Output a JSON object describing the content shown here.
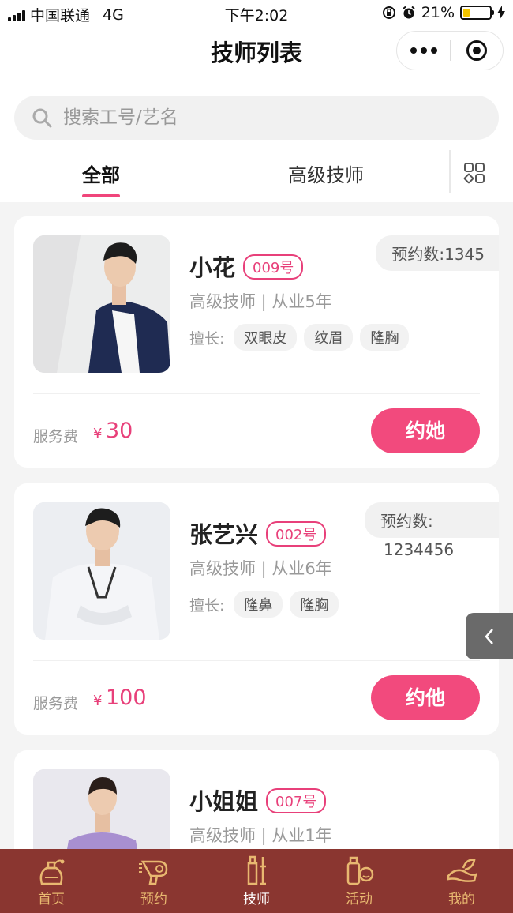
{
  "status_bar": {
    "carrier": "中国联通",
    "network": "4G",
    "time": "下午2:02",
    "battery": "21%"
  },
  "nav": {
    "title": "技师列表"
  },
  "search": {
    "placeholder": "搜索工号/艺名"
  },
  "tabs": [
    {
      "label": "全部",
      "active": true
    },
    {
      "label": "高级技师",
      "active": false
    }
  ],
  "technicians": [
    {
      "name": "小花",
      "badge": "009号",
      "title": "高级技师 | 从业5年",
      "skills_label": "擅长:",
      "skills": [
        "双眼皮",
        "纹眉",
        "隆胸"
      ],
      "count_label": "预约数:",
      "count_value": "1345",
      "fee_label": "服务费",
      "currency": "¥",
      "price": "30",
      "button": "约她"
    },
    {
      "name": "张艺兴",
      "badge": "002号",
      "title": "高级技师 | 从业6年",
      "skills_label": "擅长:",
      "skills": [
        "隆鼻",
        "隆胸"
      ],
      "count_label": "预约数:",
      "count_value": "1234456",
      "fee_label": "服务费",
      "currency": "¥",
      "price": "100",
      "button": "约他"
    },
    {
      "name": "小姐姐",
      "badge": "007号",
      "title": "高级技师 | 从业1年"
    }
  ],
  "tabbar": [
    {
      "label": "首页",
      "icon": "perfume-icon",
      "active": false
    },
    {
      "label": "预约",
      "icon": "hairdryer-icon",
      "active": false
    },
    {
      "label": "技师",
      "icon": "tools-icon",
      "active": true
    },
    {
      "label": "活动",
      "icon": "cosmetics-icon",
      "active": false
    },
    {
      "label": "我的",
      "icon": "profile-icon",
      "active": false
    }
  ],
  "colors": {
    "accent": "#f24a7d",
    "tabbar_bg": "#8a3630",
    "tabbar_label": "#e8b870"
  }
}
